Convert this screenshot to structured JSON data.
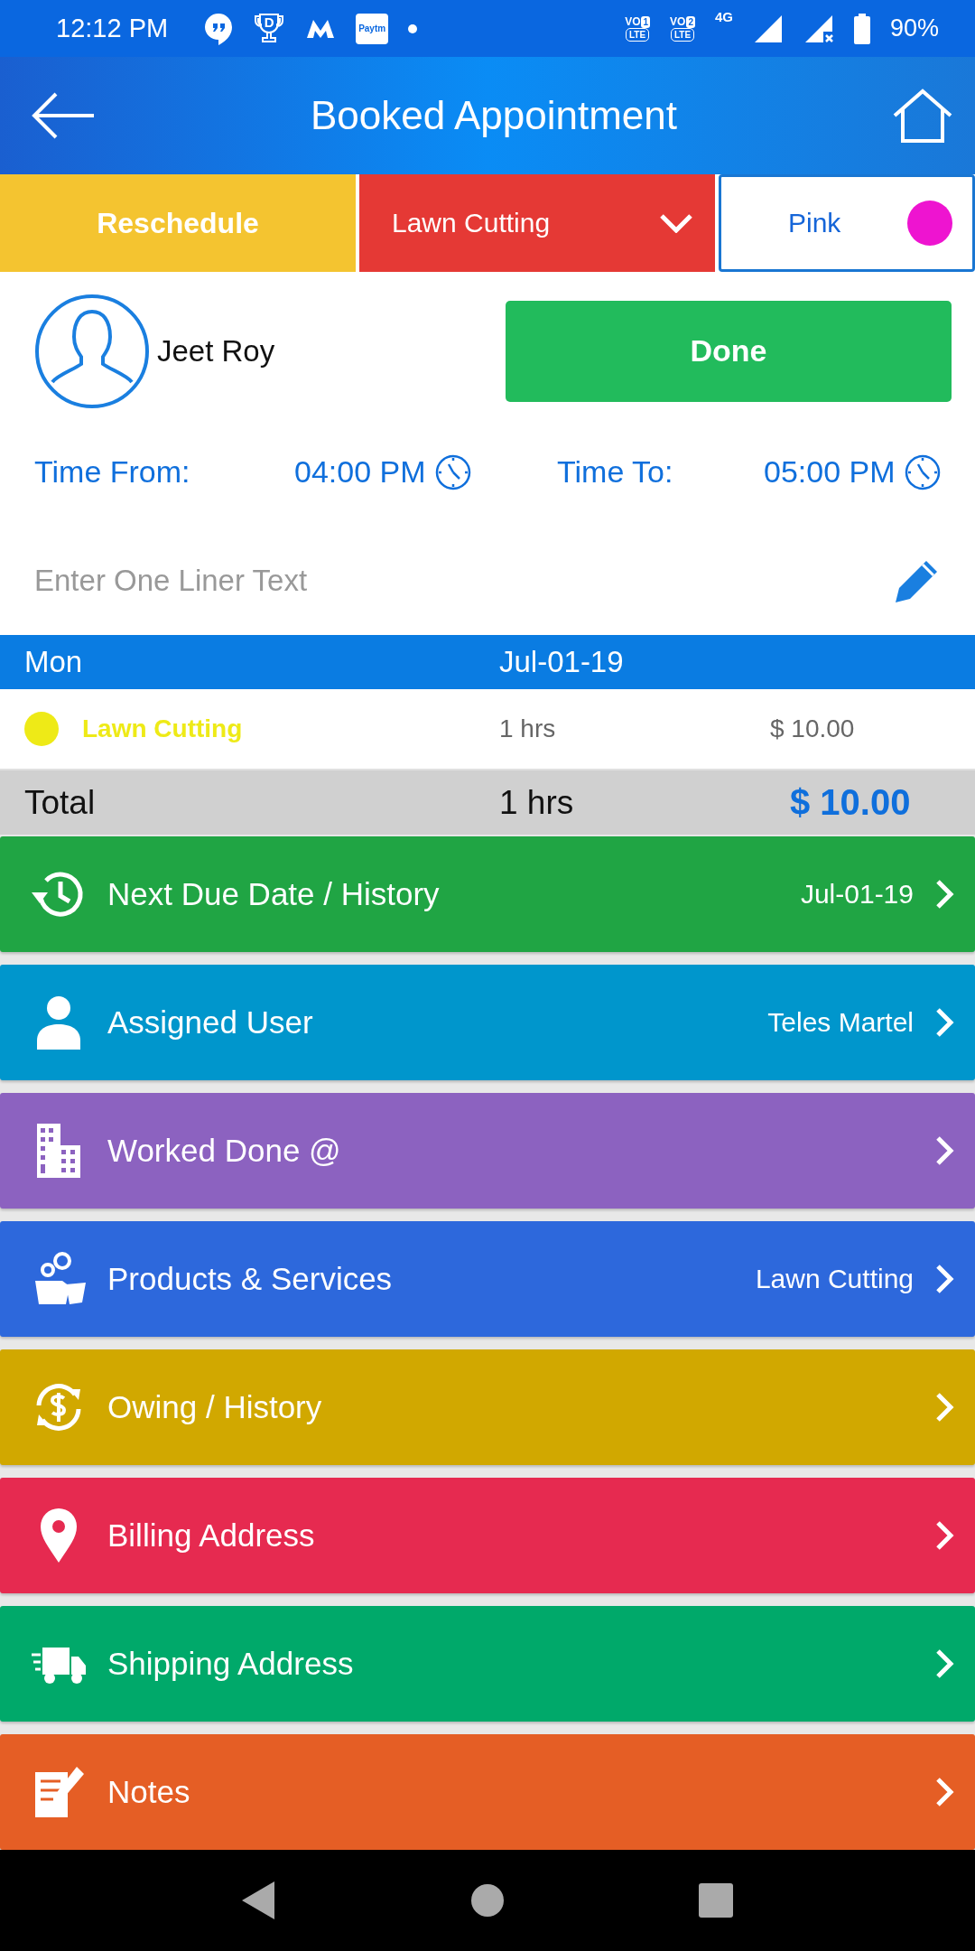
{
  "status_bar": {
    "time": "12:12 PM",
    "notifications": [
      {
        "kind": "chat"
      },
      {
        "kind": "trophy",
        "label": "D"
      },
      {
        "kind": "m-logo"
      },
      {
        "kind": "wallet",
        "label": "Paytm"
      },
      {
        "kind": "dot"
      }
    ],
    "sims": [
      {
        "top": "VO",
        "num": "1",
        "bottom": "LTE"
      },
      {
        "top": "VO",
        "num": "2",
        "bottom": "LTE"
      }
    ],
    "network": "4G",
    "battery": "90%"
  },
  "app_bar": {
    "title": "Booked Appointment"
  },
  "actions": {
    "reschedule": "Reschedule",
    "service": "Lawn Cutting",
    "color_choice": {
      "label": "Pink",
      "color": "#ee14d0"
    }
  },
  "customer": {
    "name": "Jeet Roy",
    "done_button": "Done"
  },
  "times": [
    {
      "label": "Time From:",
      "value": "04:00 PM"
    },
    {
      "label": "Time To:",
      "value": "05:00 PM"
    }
  ],
  "one_liner": {
    "placeholder": "Enter One Liner Text"
  },
  "day_header": {
    "day": "Mon",
    "date": "Jul-01-19"
  },
  "items": [
    {
      "name": "Lawn Cutting",
      "color": "#eeea17",
      "hours": "1 hrs",
      "price": "$ 10.00"
    }
  ],
  "total": {
    "label": "Total",
    "hours": "1 hrs",
    "amount": "$ 10.00"
  },
  "menu": [
    {
      "kind": "history",
      "label": "Next Due Date / History",
      "value": "Jul-01-19",
      "color": "#20a544"
    },
    {
      "kind": "user",
      "label": "Assigned User",
      "value": "Teles Martel",
      "color": "#0096cc"
    },
    {
      "kind": "buildings",
      "label": "Worked Done @",
      "color": "#8c62c0"
    },
    {
      "kind": "products",
      "label": "Products & Services",
      "value": "Lawn Cutting",
      "color": "#2d68dc"
    },
    {
      "kind": "owing",
      "label": "Owing / History",
      "color": "#d1a800"
    },
    {
      "kind": "location",
      "label": "Billing Address",
      "color": "#e62a50"
    },
    {
      "kind": "truck",
      "label": "Shipping Address",
      "color": "#00a96a"
    },
    {
      "kind": "notes",
      "label": "Notes",
      "color": "#e55e25"
    }
  ]
}
